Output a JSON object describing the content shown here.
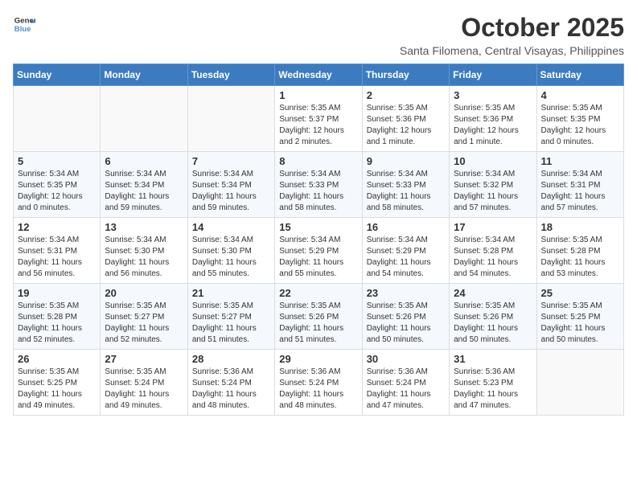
{
  "logo": {
    "text_general": "General",
    "text_blue": "Blue"
  },
  "title": "October 2025",
  "subtitle": "Santa Filomena, Central Visayas, Philippines",
  "weekdays": [
    "Sunday",
    "Monday",
    "Tuesday",
    "Wednesday",
    "Thursday",
    "Friday",
    "Saturday"
  ],
  "weeks": [
    [
      {
        "day": "",
        "info": ""
      },
      {
        "day": "",
        "info": ""
      },
      {
        "day": "",
        "info": ""
      },
      {
        "day": "1",
        "info": "Sunrise: 5:35 AM\nSunset: 5:37 PM\nDaylight: 12 hours\nand 2 minutes."
      },
      {
        "day": "2",
        "info": "Sunrise: 5:35 AM\nSunset: 5:36 PM\nDaylight: 12 hours\nand 1 minute."
      },
      {
        "day": "3",
        "info": "Sunrise: 5:35 AM\nSunset: 5:36 PM\nDaylight: 12 hours\nand 1 minute."
      },
      {
        "day": "4",
        "info": "Sunrise: 5:35 AM\nSunset: 5:35 PM\nDaylight: 12 hours\nand 0 minutes."
      }
    ],
    [
      {
        "day": "5",
        "info": "Sunrise: 5:34 AM\nSunset: 5:35 PM\nDaylight: 12 hours\nand 0 minutes."
      },
      {
        "day": "6",
        "info": "Sunrise: 5:34 AM\nSunset: 5:34 PM\nDaylight: 11 hours\nand 59 minutes."
      },
      {
        "day": "7",
        "info": "Sunrise: 5:34 AM\nSunset: 5:34 PM\nDaylight: 11 hours\nand 59 minutes."
      },
      {
        "day": "8",
        "info": "Sunrise: 5:34 AM\nSunset: 5:33 PM\nDaylight: 11 hours\nand 58 minutes."
      },
      {
        "day": "9",
        "info": "Sunrise: 5:34 AM\nSunset: 5:33 PM\nDaylight: 11 hours\nand 58 minutes."
      },
      {
        "day": "10",
        "info": "Sunrise: 5:34 AM\nSunset: 5:32 PM\nDaylight: 11 hours\nand 57 minutes."
      },
      {
        "day": "11",
        "info": "Sunrise: 5:34 AM\nSunset: 5:31 PM\nDaylight: 11 hours\nand 57 minutes."
      }
    ],
    [
      {
        "day": "12",
        "info": "Sunrise: 5:34 AM\nSunset: 5:31 PM\nDaylight: 11 hours\nand 56 minutes."
      },
      {
        "day": "13",
        "info": "Sunrise: 5:34 AM\nSunset: 5:30 PM\nDaylight: 11 hours\nand 56 minutes."
      },
      {
        "day": "14",
        "info": "Sunrise: 5:34 AM\nSunset: 5:30 PM\nDaylight: 11 hours\nand 55 minutes."
      },
      {
        "day": "15",
        "info": "Sunrise: 5:34 AM\nSunset: 5:29 PM\nDaylight: 11 hours\nand 55 minutes."
      },
      {
        "day": "16",
        "info": "Sunrise: 5:34 AM\nSunset: 5:29 PM\nDaylight: 11 hours\nand 54 minutes."
      },
      {
        "day": "17",
        "info": "Sunrise: 5:34 AM\nSunset: 5:28 PM\nDaylight: 11 hours\nand 54 minutes."
      },
      {
        "day": "18",
        "info": "Sunrise: 5:35 AM\nSunset: 5:28 PM\nDaylight: 11 hours\nand 53 minutes."
      }
    ],
    [
      {
        "day": "19",
        "info": "Sunrise: 5:35 AM\nSunset: 5:28 PM\nDaylight: 11 hours\nand 52 minutes."
      },
      {
        "day": "20",
        "info": "Sunrise: 5:35 AM\nSunset: 5:27 PM\nDaylight: 11 hours\nand 52 minutes."
      },
      {
        "day": "21",
        "info": "Sunrise: 5:35 AM\nSunset: 5:27 PM\nDaylight: 11 hours\nand 51 minutes."
      },
      {
        "day": "22",
        "info": "Sunrise: 5:35 AM\nSunset: 5:26 PM\nDaylight: 11 hours\nand 51 minutes."
      },
      {
        "day": "23",
        "info": "Sunrise: 5:35 AM\nSunset: 5:26 PM\nDaylight: 11 hours\nand 50 minutes."
      },
      {
        "day": "24",
        "info": "Sunrise: 5:35 AM\nSunset: 5:26 PM\nDaylight: 11 hours\nand 50 minutes."
      },
      {
        "day": "25",
        "info": "Sunrise: 5:35 AM\nSunset: 5:25 PM\nDaylight: 11 hours\nand 50 minutes."
      }
    ],
    [
      {
        "day": "26",
        "info": "Sunrise: 5:35 AM\nSunset: 5:25 PM\nDaylight: 11 hours\nand 49 minutes."
      },
      {
        "day": "27",
        "info": "Sunrise: 5:35 AM\nSunset: 5:24 PM\nDaylight: 11 hours\nand 49 minutes."
      },
      {
        "day": "28",
        "info": "Sunrise: 5:36 AM\nSunset: 5:24 PM\nDaylight: 11 hours\nand 48 minutes."
      },
      {
        "day": "29",
        "info": "Sunrise: 5:36 AM\nSunset: 5:24 PM\nDaylight: 11 hours\nand 48 minutes."
      },
      {
        "day": "30",
        "info": "Sunrise: 5:36 AM\nSunset: 5:24 PM\nDaylight: 11 hours\nand 47 minutes."
      },
      {
        "day": "31",
        "info": "Sunrise: 5:36 AM\nSunset: 5:23 PM\nDaylight: 11 hours\nand 47 minutes."
      },
      {
        "day": "",
        "info": ""
      }
    ]
  ]
}
